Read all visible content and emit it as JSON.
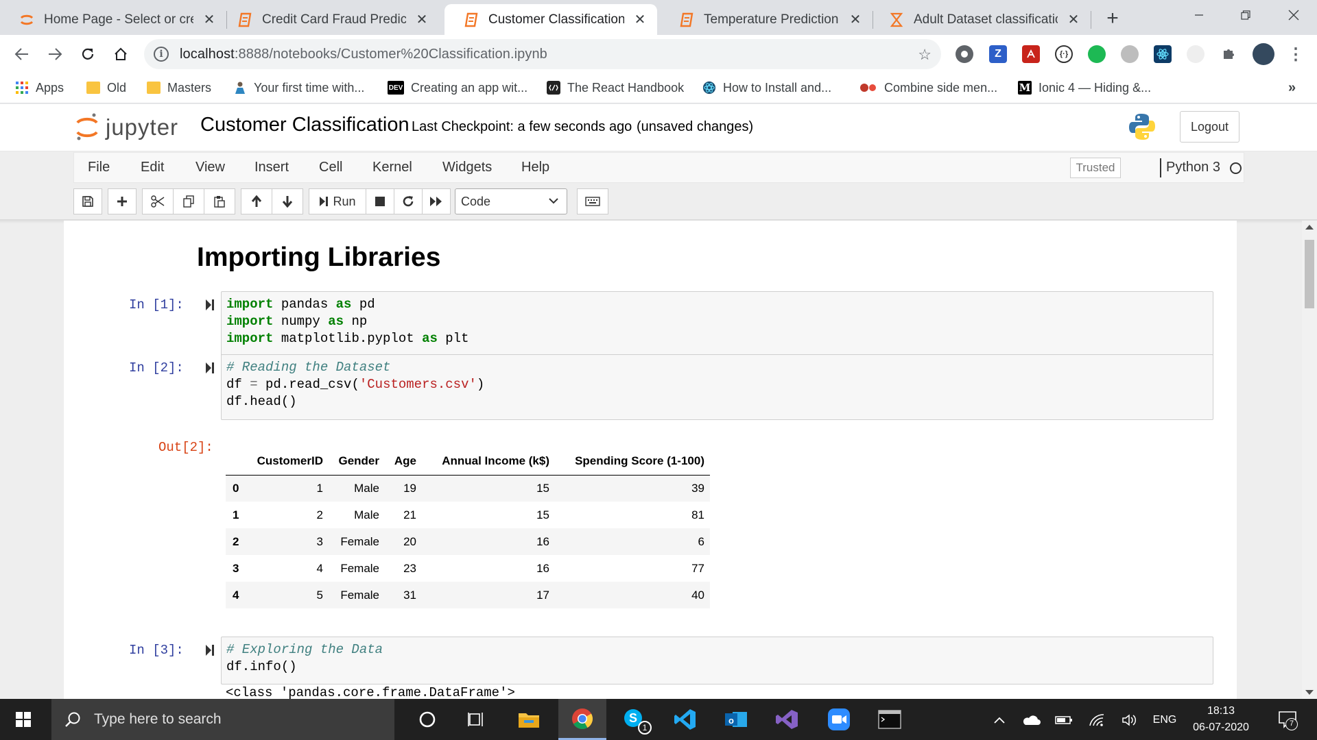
{
  "browser": {
    "tabs": [
      {
        "title": "Home Page - Select or crea",
        "icon": "jupyter-spinner-icon",
        "active": false
      },
      {
        "title": "Credit Card Fraud Predictio",
        "icon": "notebook-icon",
        "active": false
      },
      {
        "title": "Customer Classification - Ju",
        "icon": "notebook-icon",
        "active": true
      },
      {
        "title": "Temperature Prediction - Ju",
        "icon": "notebook-icon",
        "active": false
      },
      {
        "title": "Adult Dataset classification",
        "icon": "hourglass-icon",
        "active": false
      }
    ],
    "new_tab": "+",
    "url_host": "localhost",
    "url_rest": ":8888/notebooks/Customer%20Classification.ipynb",
    "ext_z_label": "Z",
    "bookmarks": [
      {
        "label": "Apps",
        "icon": "apps-grid-icon"
      },
      {
        "label": "Old",
        "icon": "folder-icon"
      },
      {
        "label": "Masters",
        "icon": "folder-icon"
      },
      {
        "label": "Your first time with...",
        "icon": "person-icon"
      },
      {
        "label": "Creating an app wit...",
        "icon": "dev-icon"
      },
      {
        "label": "The React Handbook",
        "icon": "react-handbook-icon"
      },
      {
        "label": "How to Install and...",
        "icon": "react-icon"
      },
      {
        "label": "Combine side men...",
        "icon": "dots-icon"
      },
      {
        "label": "Ionic 4 — Hiding &...",
        "icon": "medium-icon"
      }
    ],
    "bookmarks_more": "»",
    "dev_icon_text": "DEV",
    "medium_icon_text": "M"
  },
  "jupyter": {
    "logo_text": "jupyter",
    "notebook_name": "Customer Classification",
    "checkpoint": "Last Checkpoint: a few seconds ago",
    "unsaved": "(unsaved changes)",
    "logout": "Logout",
    "menu": [
      "File",
      "Edit",
      "View",
      "Insert",
      "Cell",
      "Kernel",
      "Widgets",
      "Help"
    ],
    "trusted": "Trusted",
    "kernel": "Python 3",
    "run_label": "Run",
    "cell_type": "Code"
  },
  "notebook": {
    "heading": "Importing Libraries",
    "cells": [
      {
        "prompt": "In [1]:",
        "lines": [
          [
            {
              "t": "import",
              "c": "kw"
            },
            {
              "t": " pandas ",
              "c": ""
            },
            {
              "t": "as",
              "c": "kw"
            },
            {
              "t": " pd",
              "c": ""
            }
          ],
          [
            {
              "t": "import",
              "c": "kw"
            },
            {
              "t": " numpy ",
              "c": ""
            },
            {
              "t": "as",
              "c": "kw"
            },
            {
              "t": " np",
              "c": ""
            }
          ],
          [
            {
              "t": "import",
              "c": "kw"
            },
            {
              "t": " matplotlib.pyplot ",
              "c": ""
            },
            {
              "t": "as",
              "c": "kw"
            },
            {
              "t": " plt",
              "c": ""
            }
          ]
        ]
      },
      {
        "prompt": "In [2]:",
        "lines": [
          [
            {
              "t": "# Reading the Dataset",
              "c": "cm"
            }
          ],
          [
            {
              "t": "df ",
              "c": ""
            },
            {
              "t": "=",
              "c": "op"
            },
            {
              "t": " pd.read_csv(",
              "c": ""
            },
            {
              "t": "'Customers.csv'",
              "c": "st"
            },
            {
              "t": ")",
              "c": ""
            }
          ],
          [
            {
              "t": "df.head()",
              "c": ""
            }
          ]
        ]
      },
      {
        "prompt": "In [3]:",
        "lines": [
          [
            {
              "t": "# Exploring the Data",
              "c": "cm"
            }
          ],
          [
            {
              "t": "df.info()",
              "c": ""
            }
          ]
        ]
      }
    ],
    "out_prompt": "Out[2]:",
    "table": {
      "columns": [
        "",
        "CustomerID",
        "Gender",
        "Age",
        "Annual Income (k$)",
        "Spending Score (1-100)"
      ],
      "rows": [
        [
          "0",
          "1",
          "Male",
          "19",
          "15",
          "39"
        ],
        [
          "1",
          "2",
          "Male",
          "21",
          "15",
          "81"
        ],
        [
          "2",
          "3",
          "Female",
          "20",
          "16",
          "6"
        ],
        [
          "3",
          "4",
          "Female",
          "23",
          "16",
          "77"
        ],
        [
          "4",
          "5",
          "Female",
          "31",
          "17",
          "40"
        ]
      ]
    },
    "info_output_partial": "<class 'pandas.core.frame.DataFrame'>"
  },
  "taskbar": {
    "search_placeholder": "Type here to search",
    "skype_badge": "1",
    "language": "ENG",
    "time": "18:13",
    "date": "06-07-2020",
    "notification_count": "7"
  }
}
